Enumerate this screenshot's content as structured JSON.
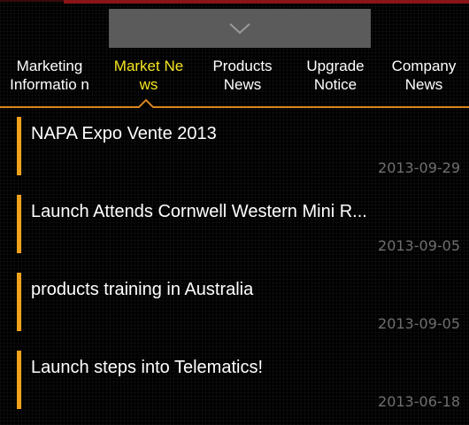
{
  "pull_handle": {
    "icon": "chevron-down-icon"
  },
  "tabs": [
    {
      "label": "Marketing Informatio n",
      "active": false
    },
    {
      "label": "Market Ne ws",
      "active": true
    },
    {
      "label": "Products News",
      "active": false
    },
    {
      "label": "Upgrade Notice",
      "active": false
    },
    {
      "label": "Company News",
      "active": false
    }
  ],
  "news": [
    {
      "title": "NAPA Expo Vente 2013",
      "date": "2013-09-29"
    },
    {
      "title": "Launch Attends Cornwell Western Mini R...",
      "date": "2013-09-05"
    },
    {
      "title": "products training in Australia",
      "date": "2013-09-05"
    },
    {
      "title": "Launch steps into Telematics!",
      "date": "2013-06-18"
    }
  ],
  "colors": {
    "active_tab": "#f5e622",
    "accent": "#d6841c",
    "item_bar": "#f0a21a",
    "date": "#6e6e6e"
  }
}
